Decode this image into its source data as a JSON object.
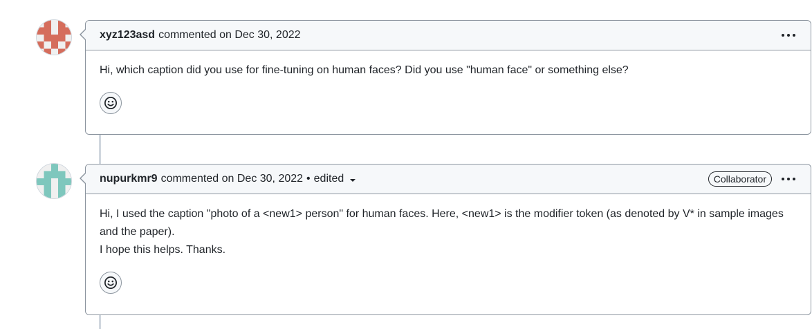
{
  "comments": [
    {
      "author": "xyz123asd",
      "action": "commented on Dec 30, 2022",
      "edited": "",
      "badge": "",
      "body": [
        "Hi, which caption did you use for fine-tuning on human faces? Did you use \"human face\" or something else?"
      ],
      "avatar_color": "#d56d5c",
      "reaction_icon": "smiley-icon",
      "menu_icon": "kebab-horizontal-icon"
    },
    {
      "author": "nupurkmr9",
      "action": "commented on Dec 30, 2022",
      "separator": "•",
      "edited": "edited",
      "badge": "Collaborator",
      "body": [
        "Hi, I used the caption \"photo of a <new1> person\" for human faces. Here, <new1> is the modifier token (as denoted by V* in sample images and the paper).",
        "I hope this helps. Thanks."
      ],
      "avatar_color": "#7ec7bd",
      "reaction_icon": "smiley-icon",
      "menu_icon": "kebab-horizontal-icon"
    }
  ],
  "colors": {
    "border": "#8c959f",
    "header_bg": "#f6f8fa",
    "timeline": "#d0d7de"
  }
}
